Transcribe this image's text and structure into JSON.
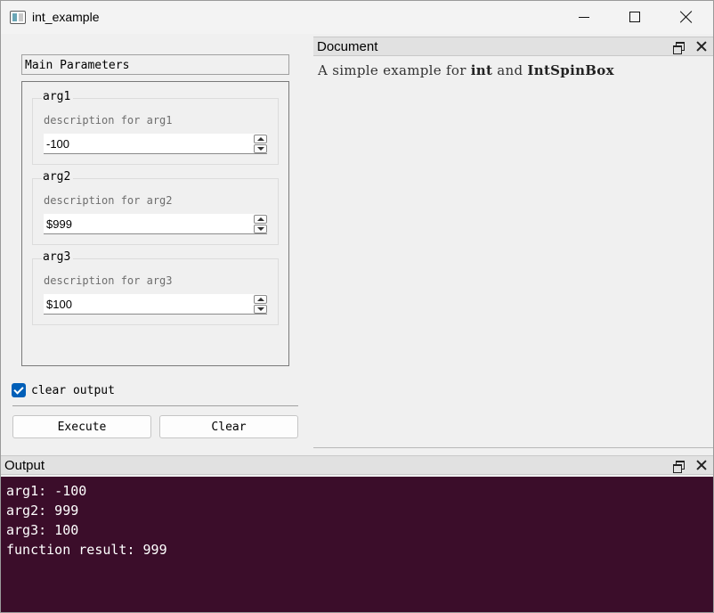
{
  "window": {
    "title": "int_example"
  },
  "main_params": {
    "header": "Main Parameters",
    "groups": [
      {
        "title": "arg1",
        "description": "description for arg1",
        "value": "-100"
      },
      {
        "title": "arg2",
        "description": "description for arg2",
        "value": "$999"
      },
      {
        "title": "arg3",
        "description": "description for arg3",
        "value": "$100"
      }
    ]
  },
  "clear_output": {
    "label": "clear output",
    "checked": true
  },
  "buttons": {
    "execute": "Execute",
    "clear": "Clear"
  },
  "document_dock": {
    "title": "Document",
    "text_prefix": "A simple example for ",
    "text_bold1": "int",
    "text_middle": " and ",
    "text_bold2": "IntSpinBox"
  },
  "output_dock": {
    "title": "Output",
    "lines": [
      "arg1: -100",
      "arg2: 999",
      "arg3: 100",
      "function result: 999"
    ]
  },
  "colors": {
    "output_bg": "#3b0d2a",
    "checkbox_accent": "#005fb8"
  },
  "icons": {
    "app": "app-window-icon",
    "minimize": "minimize-icon",
    "maximize": "maximize-icon",
    "close": "close-icon",
    "float": "float-dock-icon",
    "spin_up": "spin-up-arrow-icon",
    "spin_down": "spin-down-arrow-icon",
    "check": "checkmark-icon"
  }
}
